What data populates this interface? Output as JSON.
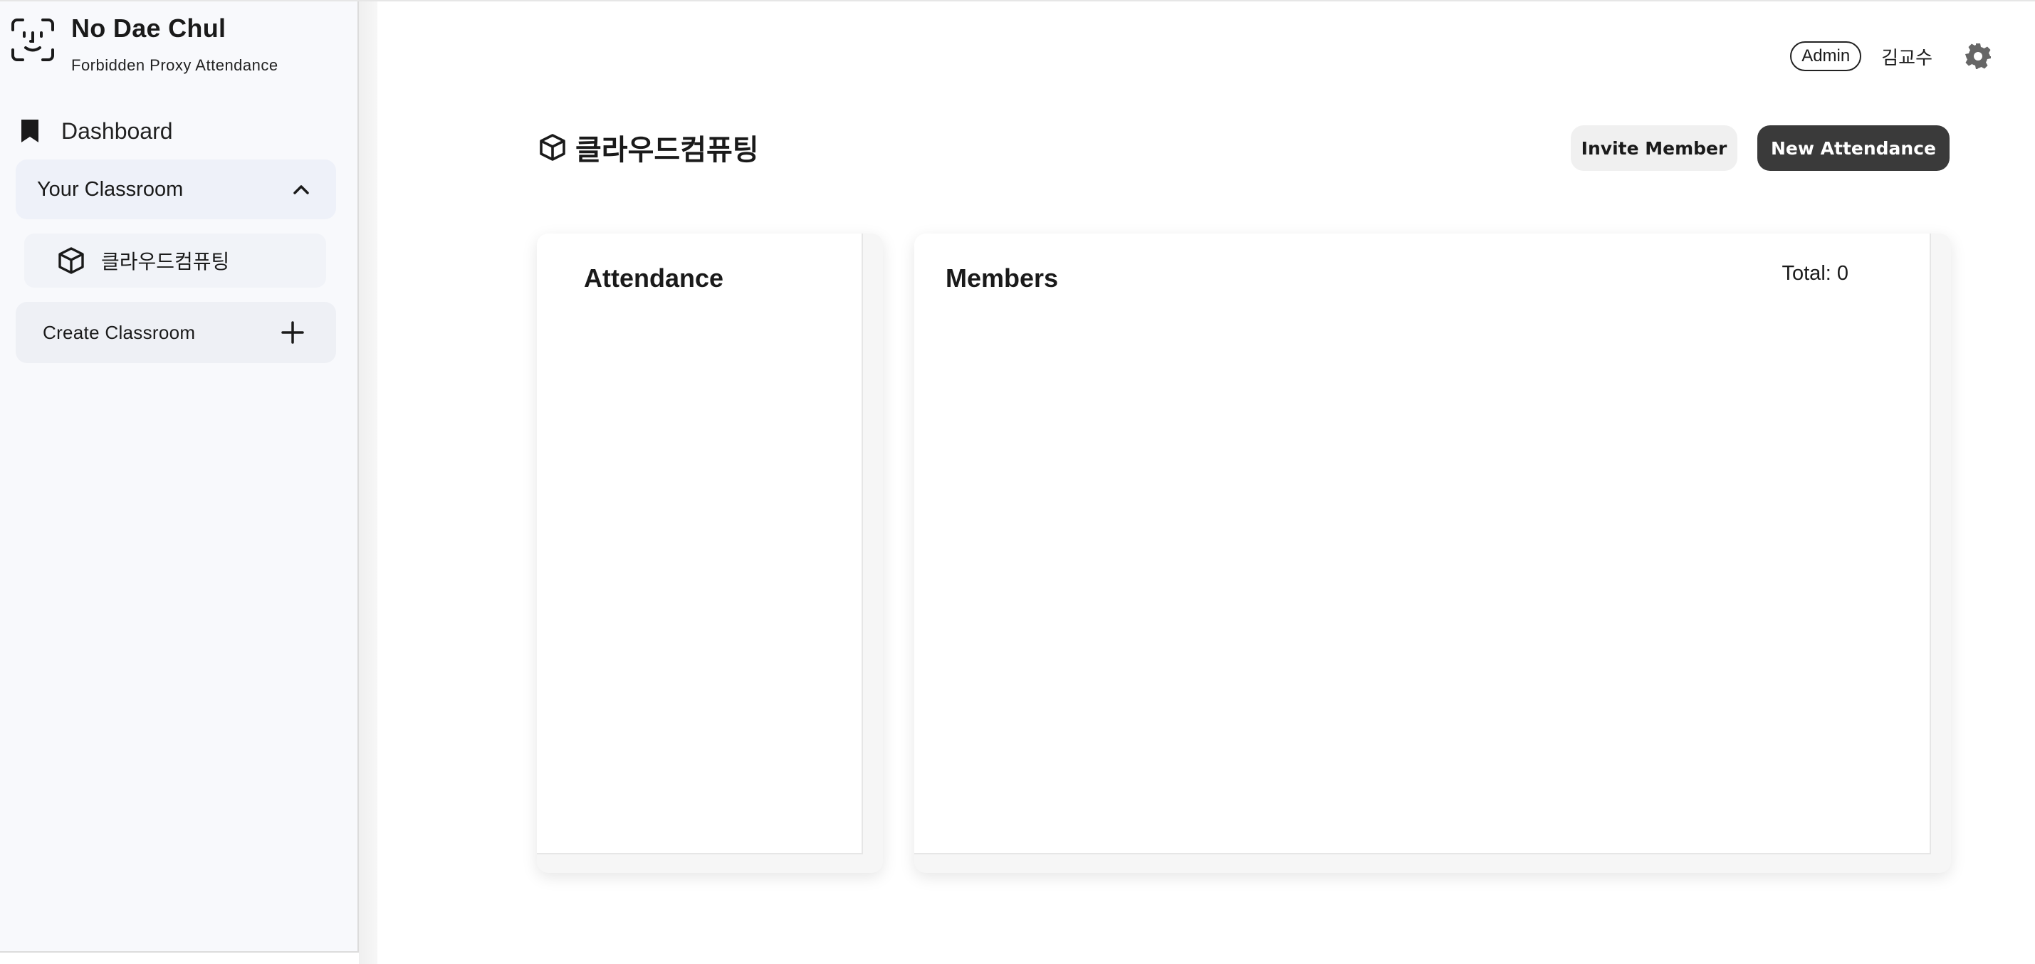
{
  "brand": {
    "title": "No Dae Chul",
    "subtitle": "Forbidden Proxy Attendance",
    "icon": "face-id-icon"
  },
  "sidebar": {
    "dashboard_label": "Dashboard",
    "group_label": "Your Classroom",
    "classrooms": [
      {
        "label": "클라우드컴퓨팅",
        "icon": "cube-icon"
      }
    ],
    "create_label": "Create Classroom"
  },
  "topbar": {
    "role": "Admin",
    "user": "김교수"
  },
  "main": {
    "title": "클라우드컴퓨팅",
    "invite_label": "Invite Member",
    "new_attendance_label": "New Attendance",
    "attendance_title": "Attendance",
    "members_title": "Members",
    "total_label": "Total: 0"
  },
  "colors": {
    "sidebar_bg": "#f8f9fc",
    "primary_button": "#3a3a3a",
    "secondary_button": "#f0f0f0"
  }
}
